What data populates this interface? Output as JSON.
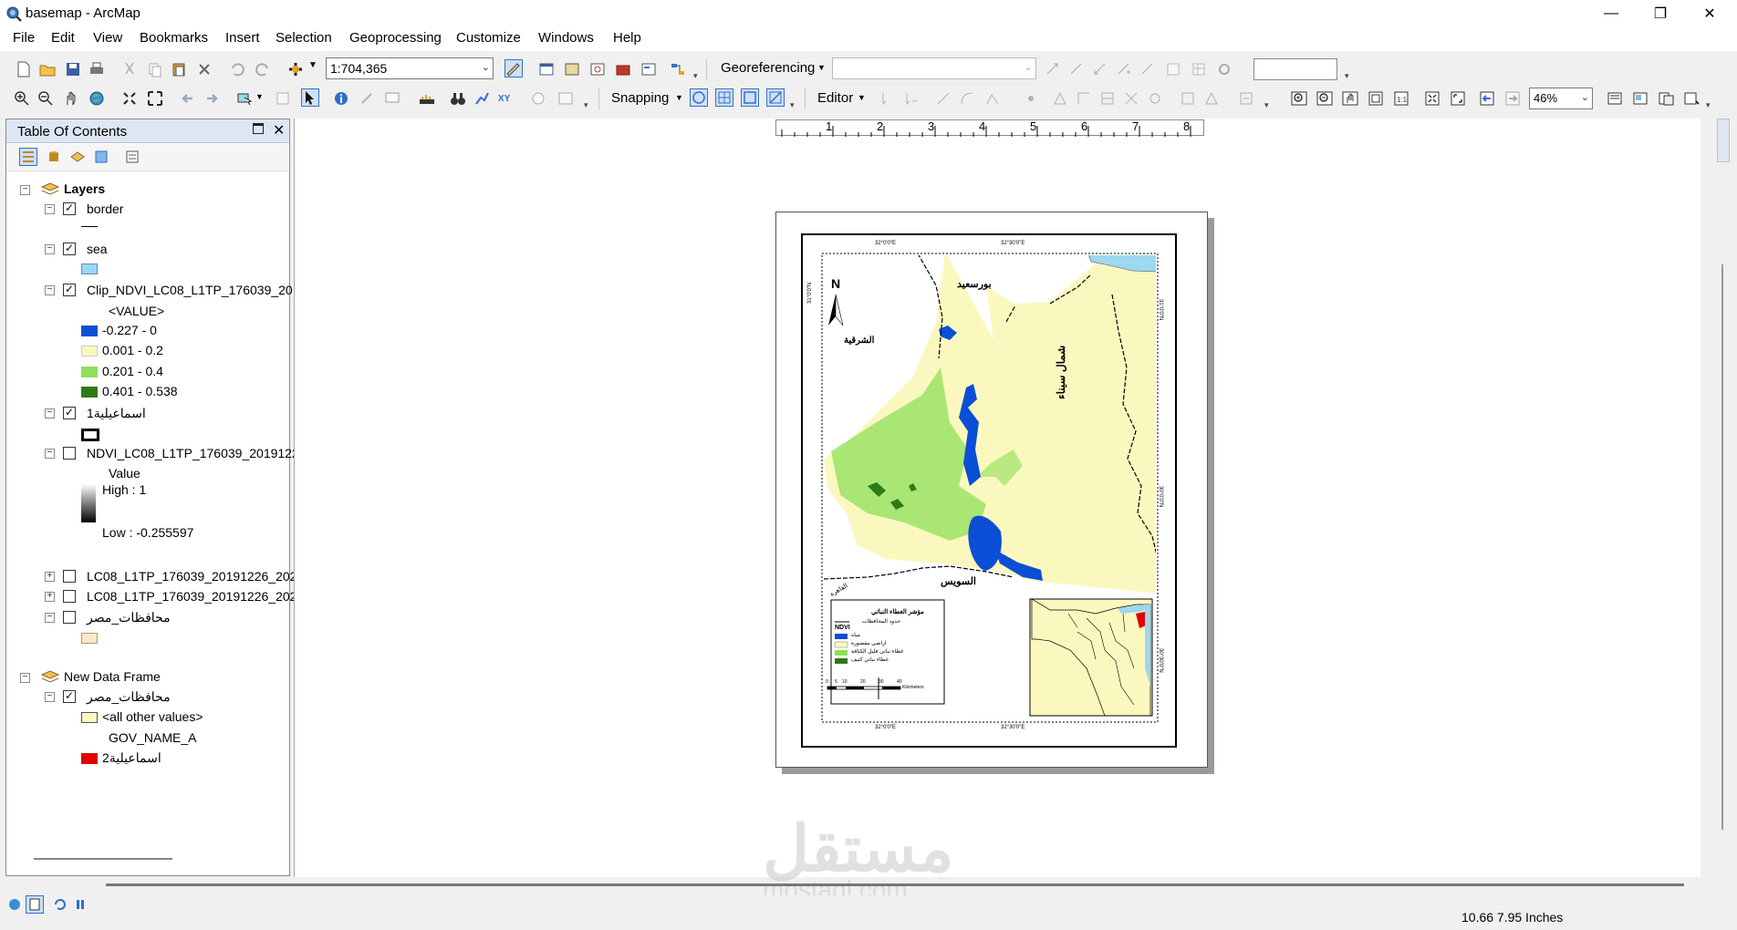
{
  "window": {
    "title": "basemap - ArcMap",
    "minimize": "—",
    "maximize": "❐",
    "close": "✕"
  },
  "menu": [
    "File",
    "Edit",
    "View",
    "Bookmarks",
    "Insert",
    "Selection",
    "Geoprocessing",
    "Customize",
    "Windows",
    "Help"
  ],
  "toolbar1": {
    "scale": "1:704,365",
    "georeferencing": "Georeferencing"
  },
  "toolbar2": {
    "snapping": "Snapping",
    "editor": "Editor",
    "zoom": "46%"
  },
  "toc": {
    "title": "Table Of Contents",
    "layers_group": "Layers",
    "items": [
      {
        "name": "border"
      },
      {
        "name": "sea"
      },
      {
        "name": "Clip_NDVI_LC08_L1TP_176039_20",
        "field": "<VALUE>",
        "classes": [
          {
            "label": "-0.227 - 0",
            "color": "#0a4fd6"
          },
          {
            "label": "0.001 - 0.2",
            "color": "#fbf8bf"
          },
          {
            "label": "0.201 - 0.4",
            "color": "#8fe05a"
          },
          {
            "label": "0.401 - 0.538",
            "color": "#2d7a17"
          }
        ]
      },
      {
        "name": "اسماعيلية1"
      },
      {
        "name": "NDVI_LC08_L1TP_176039_2019122",
        "field": "Value",
        "high": "High : 1",
        "low": "Low : -0.255597"
      },
      {
        "name": "LC08_L1TP_176039_20191226_202"
      },
      {
        "name": "LC08_L1TP_176039_20191226_202"
      },
      {
        "name": "محافظات_مصر"
      }
    ],
    "frame2": "New Data Frame",
    "frame2_items": [
      {
        "name": "محافظات_مصر",
        "other": "<all other values>",
        "field": "GOV_NAME_A",
        "class": "اسماعيلية2"
      }
    ]
  },
  "ruler": [
    "1",
    "2",
    "3",
    "4",
    "5",
    "6",
    "7",
    "8"
  ],
  "map_layout": {
    "north": "N",
    "labels": {
      "portsaid": "بورسعيد",
      "sharqia": "الشرقية",
      "north_sinai": "شمال سيناء",
      "suez": "السويس",
      "cairo": "القاهرة"
    },
    "grid_top": [
      "32°0'0\"E",
      "32°30'0\"E"
    ],
    "grid_bottom": [
      "32°0'0\"E",
      "32°30'0\"E"
    ],
    "grid_left": "31°0'0\"N",
    "grid_right": [
      "31°0'0\"N",
      "30°0'0\"N",
      "30°30'0\"N"
    ],
    "legend": {
      "title": "مؤشر الغطاء النباتي",
      "border": "حدود المحافظات",
      "ndvi": "NDVI",
      "classes": [
        {
          "label": "مياه",
          "color": "#0a4fd6"
        },
        {
          "label": "اراضي مقصورة",
          "color": "#fbf8bf"
        },
        {
          "label": "غطاء نباتي قليل الكثافة",
          "color": "#8fe05a"
        },
        {
          "label": "غطاء نباتي كثيف",
          "color": "#2d7a17"
        }
      ]
    },
    "scale_ticks": [
      "0",
      "5",
      "10",
      "20",
      "30",
      "40"
    ],
    "scale_unit": "Kilometers"
  },
  "status": {
    "coords": "10.66  7.95 Inches"
  },
  "watermark": {
    "text": "مستقل",
    "url": "mostaql.com"
  }
}
